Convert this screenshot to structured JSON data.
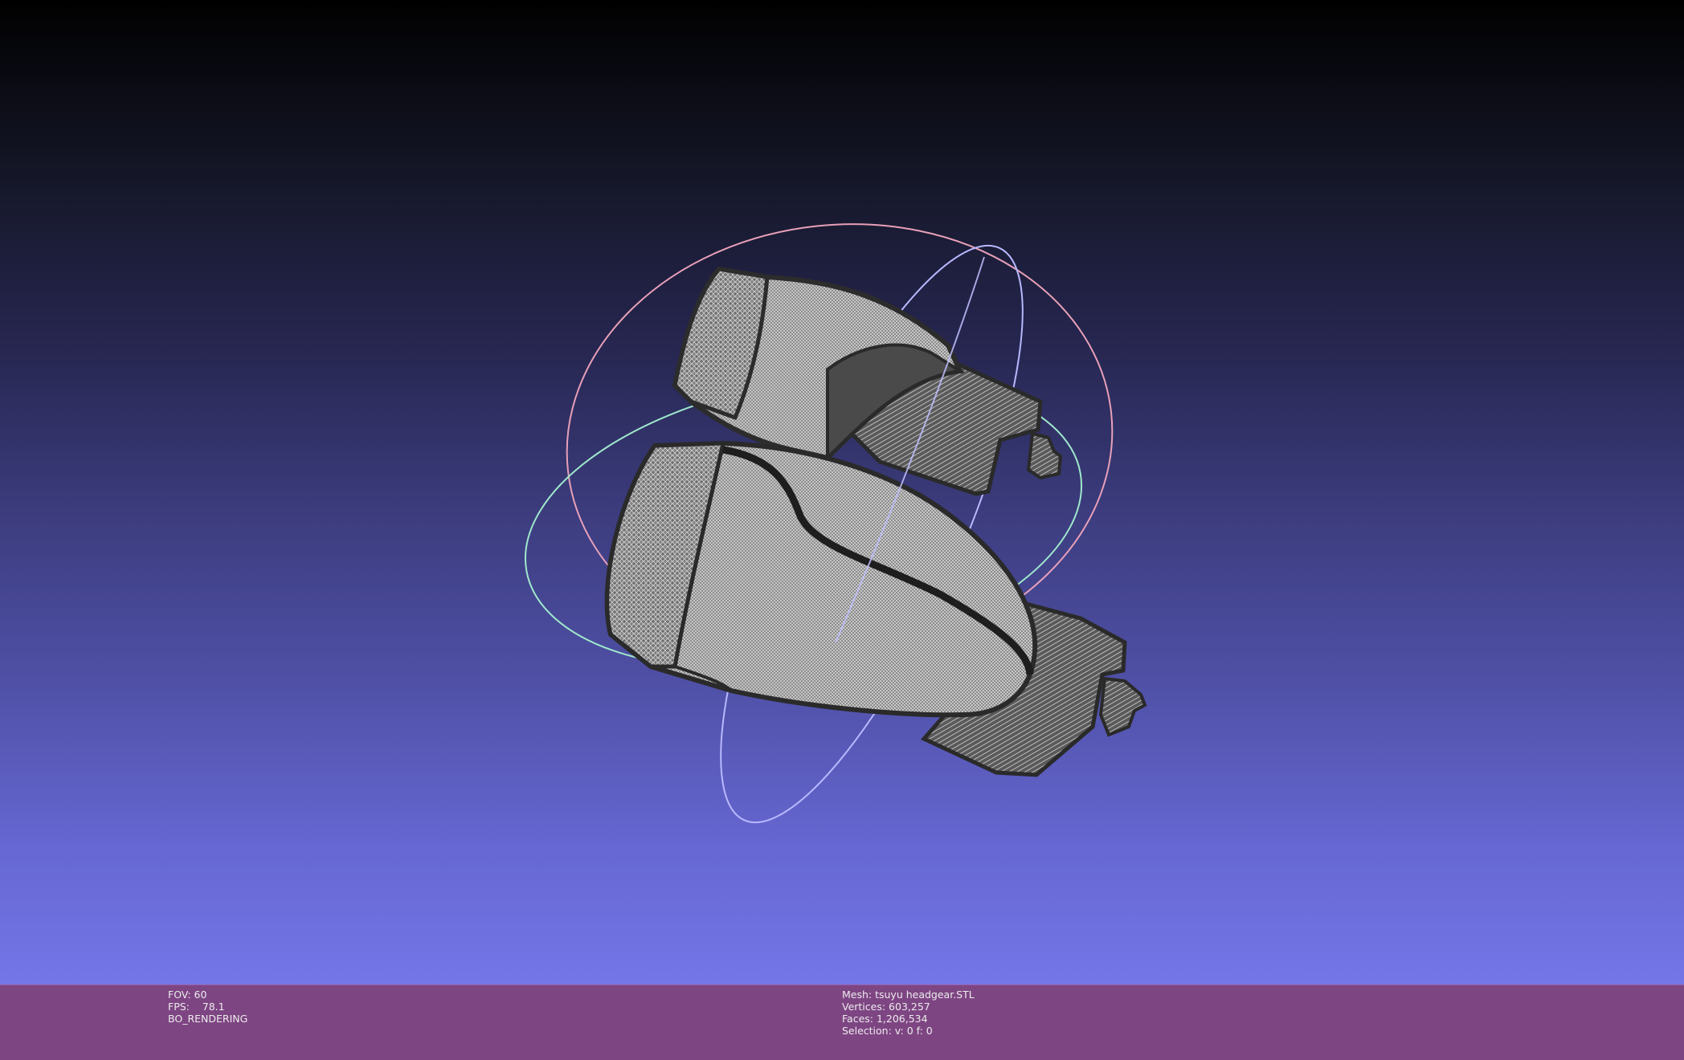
{
  "viewer": {
    "background_top": "#000000",
    "background_bottom": "#7476e8",
    "mesh_color": "#cfcfcf",
    "trackball_colors": {
      "x_ring": "#e89fb8",
      "y_ring": "#b4b4ff",
      "z_ring": "#a8f0d0"
    }
  },
  "statusbar": {
    "left": {
      "fov": "FOV: 60",
      "fps": "FPS:    78.1",
      "render_mode": "BO_RENDERING"
    },
    "right": {
      "mesh": "Mesh: tsuyu headgear.STL",
      "vertices": "Vertices: 603,257",
      "faces": "Faces: 1,206,534",
      "selection": "Selection: v: 0 f: 0"
    }
  }
}
